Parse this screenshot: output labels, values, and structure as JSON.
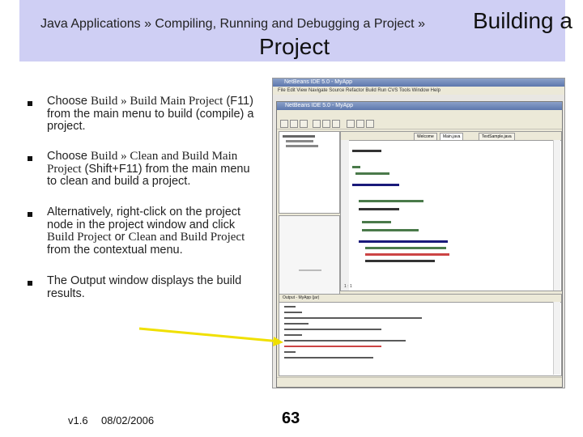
{
  "header": {
    "breadcrumb": "Java Applications » Compiling, Running and Debugging a Project »",
    "title_part1": "Building a",
    "title_part2": "Project"
  },
  "bullets": [
    {
      "line1_prefix": "Choose ",
      "line1_code": "Build » Build Main Project",
      "line1_suffix": " (F11)",
      "line2": "from the main menu to build (compile) a",
      "line3": "project."
    },
    {
      "line1_prefix": "Choose ",
      "line1_code": "Build » Clean and Build Main",
      "line2_code": "Project",
      "line2_suffix": " (Shift+F11) from the main menu",
      "line3": "to clean and build a project."
    },
    {
      "line1": "Alternatively, right-click on the project",
      "line2": "node in the project window and click",
      "line3_code1": "Build Project",
      "line3_mid": " or ",
      "line3_code2": "Clean and Build Project",
      "line4": "from the contextual menu."
    },
    {
      "line1": "The Output window displays the build",
      "line2": "results."
    }
  ],
  "screenshot": {
    "back_window_title": "NetBeans IDE 5.0 - MyApp",
    "front_window_title": "NetBeans IDE 5.0 - MyApp",
    "menu_items": [
      "File",
      "Edit",
      "View",
      "Navigate",
      "Source",
      "Refactor",
      "Build",
      "Run",
      "CVS",
      "Tools",
      "Window",
      "Help"
    ],
    "editor_tabs": [
      "Welcome",
      "Main.java",
      "TextSample.java"
    ],
    "output_title": "Output - MyApp (jar)",
    "line_col": "1 : 1"
  },
  "footer": {
    "version": "v1.6",
    "date": "08/02/2006",
    "page": "63"
  },
  "colors": {
    "title_band": "#cfcff4",
    "arrow": "#f0e000"
  }
}
